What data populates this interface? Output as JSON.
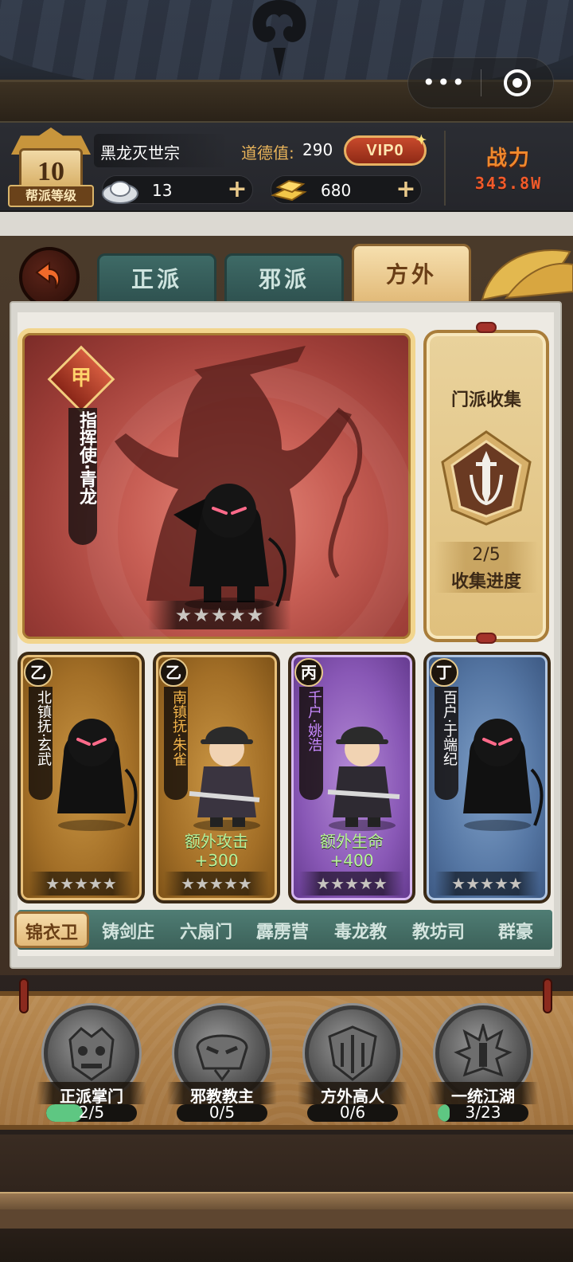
{
  "top_bar": {
    "more_icon": "more-dots-icon",
    "more_label": "•••",
    "record_icon": "record-circle-icon"
  },
  "player": {
    "level": "10",
    "level_label": "帮派等级",
    "name": "黑龙灭世宗",
    "morality_label": "道德值:",
    "morality_value": "290",
    "vip_label": "VIP0",
    "silver": "13",
    "gold": "680",
    "power_label": "战力",
    "power_value": "343.8W"
  },
  "tabs": [
    {
      "label": "正派",
      "active": false
    },
    {
      "label": "邪派",
      "active": false
    },
    {
      "label": "方外",
      "active": true
    }
  ],
  "hero": {
    "grade": "甲",
    "name": "指挥使·青龙",
    "stars": "★★★★★"
  },
  "collection": {
    "title": "门派收集",
    "count": "2/5",
    "progress_label": "收集进度"
  },
  "members": [
    {
      "grade": "乙",
      "name": "北镇抚·玄武",
      "bonus_title": "",
      "bonus_value": "",
      "stars": "★★★★★",
      "theme": "yi",
      "unlocked": false
    },
    {
      "grade": "乙",
      "name": "南镇抚·朱雀",
      "bonus_title": "额外攻击",
      "bonus_value": "+300",
      "stars": "★★★★★",
      "theme": "yi",
      "unlocked": true
    },
    {
      "grade": "丙",
      "name": "千户·姚浩",
      "bonus_title": "额外生命",
      "bonus_value": "+400",
      "stars": "★★★★★",
      "theme": "bing",
      "unlocked": true
    },
    {
      "grade": "丁",
      "name": "百户·于端纪",
      "bonus_title": "",
      "bonus_value": "",
      "stars": "★★★★★",
      "theme": "ding",
      "unlocked": false
    }
  ],
  "factions": [
    "锦衣卫",
    "铸剑庄",
    "六扇门",
    "霹雳营",
    "毒龙教",
    "教坊司",
    "群豪"
  ],
  "achievements": [
    {
      "label": "正派掌门",
      "progress": "2/5",
      "fraction": 0.4
    },
    {
      "label": "邪教教主",
      "progress": "0/5",
      "fraction": 0
    },
    {
      "label": "方外高人",
      "progress": "0/6",
      "fraction": 0
    },
    {
      "label": "一统江湖",
      "progress": "3/23",
      "fraction": 0.13
    }
  ],
  "colors": {
    "accent_gold": "#e1b977",
    "tab_teal": "#2e514f",
    "power_orange": "#f25b2b",
    "bonus_green": "#b9f39c",
    "progress_green": "#5ec782"
  }
}
